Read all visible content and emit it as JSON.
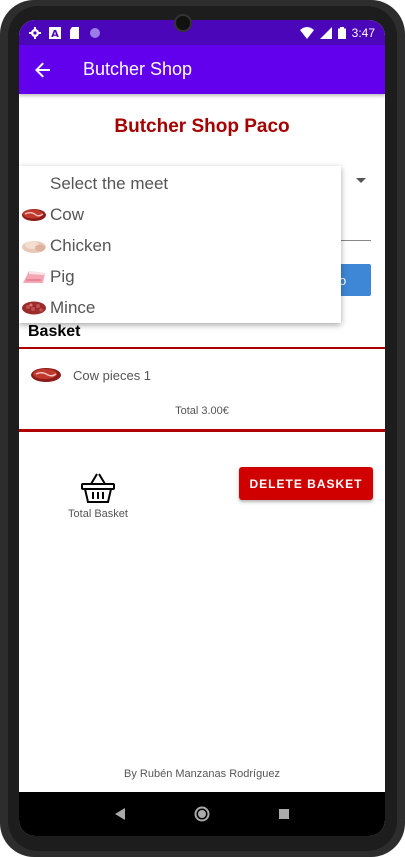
{
  "status_bar": {
    "time": "3:47"
  },
  "app_bar": {
    "title": "Butcher Shop"
  },
  "shop_title": "Butcher Shop Paco",
  "meat_select": {
    "placeholder": "Select the meet",
    "options": [
      "Cow",
      "Chicken",
      "Pig",
      "Mince"
    ]
  },
  "add_button": {
    "label": "o"
  },
  "basket": {
    "label": "Basket",
    "items": [
      {
        "text": "Cow pieces 1"
      }
    ],
    "total": "Total 3.00€"
  },
  "total_basket_label": "Total Basket",
  "delete_button": {
    "label": "DELETE BASKET"
  },
  "footer": {
    "credit": "By Rubén Manzanas Rodríguez"
  },
  "colors": {
    "status_bar": "#4c06b9",
    "app_bar": "#6200ee",
    "title_red": "#a50000",
    "delete_red": "#d10000",
    "add_blue": "#3d87d6"
  }
}
